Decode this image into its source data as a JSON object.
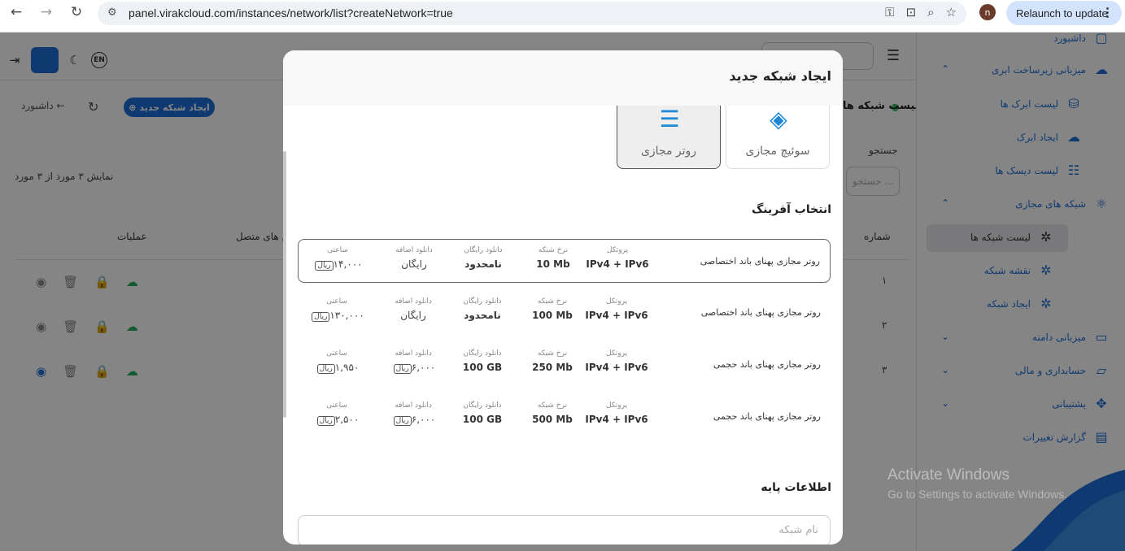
{
  "browser": {
    "url": "panel.virakcloud.com/instances/network/list?createNetwork=true",
    "avatar_letter": "n",
    "relaunch_label": "Relaunch to update"
  },
  "topbar": {
    "lang": "EN",
    "datacenter_label": "دیتاسنتر"
  },
  "page": {
    "title": "لیست شبکه ها",
    "create_button": "ایجاد شبکه جدید",
    "breadcrumb": "داشبورد ←",
    "search_label": "جستجو",
    "search_placeholder": "جستجو ...",
    "count_text": "نمایش ۳ مورد از ۳ مورد",
    "col_ops": "عملیات",
    "col_connected": "ماشین های متصل",
    "col_number": "شماره",
    "row_numbers": [
      "۱",
      "۲",
      "۳"
    ]
  },
  "sidebar": {
    "items": [
      {
        "label": "داشبورد",
        "icon": "dashboard-icon"
      },
      {
        "label": "میزبانی زیرساخت ابری",
        "icon": "cloud-icon"
      },
      {
        "label": "لیست ابرک ها",
        "icon": "cloud-list-icon"
      },
      {
        "label": "ایجاد ابرک",
        "icon": "cloud-add-icon"
      },
      {
        "label": "لیست دیسک ها",
        "icon": "disk-icon"
      },
      {
        "label": "شبکه های مجازی",
        "icon": "network-icon"
      },
      {
        "label": "لیست شبکه ها",
        "icon": "network-list-icon"
      },
      {
        "label": "نقشه شبکه",
        "icon": "network-map-icon"
      },
      {
        "label": "ایجاد شبکه",
        "icon": "network-add-icon"
      },
      {
        "label": "میزبانی دامنه",
        "icon": "domain-icon"
      },
      {
        "label": "حسابداری و مالی",
        "icon": "wallet-icon"
      },
      {
        "label": "پشتیبانی",
        "icon": "support-icon"
      },
      {
        "label": "گزارش تغییرات",
        "icon": "changelog-icon"
      }
    ]
  },
  "watermark": {
    "line1": "Activate Windows",
    "line2": "Go to Settings to activate Windows."
  },
  "modal": {
    "title": "ایجاد شبکه جدید",
    "types": [
      {
        "label": "سوئیچ مجازی",
        "selected": false
      },
      {
        "label": "روتر مجازی",
        "selected": true
      }
    ],
    "plan_section_title": "انتخاب آفرینگ",
    "col_labels": {
      "protocol": "پروتکل",
      "rate": "نرخ شبکه",
      "free_download": "دانلود رایگان",
      "extra_download": "دانلود اضافه",
      "hourly": "ساعتی"
    },
    "plans": [
      {
        "name": "روتر مجازی پهنای باند اختصاصی",
        "protocol": "IPv4 + IPv6",
        "rate": "10 Mb",
        "free_download": "نامحدود",
        "extra_download": "رایگان",
        "hourly": "۱۴,۰۰۰",
        "selected": true
      },
      {
        "name": "روتر مجازی پهنای باند اختصاصی",
        "protocol": "IPv4 + IPv6",
        "rate": "100 Mb",
        "free_download": "نامحدود",
        "extra_download": "رایگان",
        "hourly": "۱۳۰,۰۰۰",
        "selected": false
      },
      {
        "name": "روتر مجازی پهنای باند حجمی",
        "protocol": "IPv4 + IPv6",
        "rate": "250 Mb",
        "free_download": "100 GB",
        "extra_download": "۶,۰۰۰",
        "hourly": "۱,۹۵۰",
        "selected": false
      },
      {
        "name": "روتر مجازی پهنای باند حجمی",
        "protocol": "IPv4 + IPv6",
        "rate": "500 Mb",
        "free_download": "100 GB",
        "extra_download": "۶,۰۰۰",
        "hourly": "۲,۵۰۰",
        "selected": false
      }
    ],
    "rial_label": "ریال",
    "basic_section_title": "اطلاعات پایه",
    "name_placeholder": "نام شبکه"
  }
}
